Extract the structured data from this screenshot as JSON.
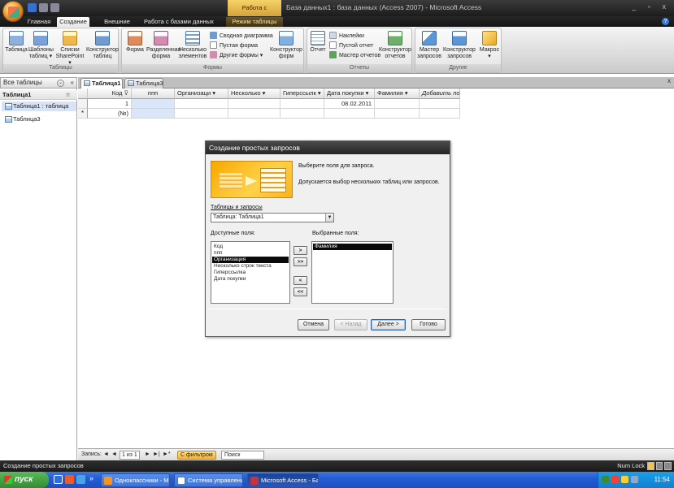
{
  "window": {
    "title": "База данных1 : база данных (Access 2007) - Microsoft Access",
    "context_label": "Работа с таблицами",
    "controls": "_ ▫ x"
  },
  "ribbon_tabs": [
    "Главная",
    "Создание",
    "Внешние данные",
    "Работа с базами данных",
    "Режим таблицы"
  ],
  "ribbon": {
    "groups": {
      "tables": "Таблицы",
      "forms": "Формы",
      "reports": "Отчеты",
      "other": "Другие"
    },
    "tables": [
      "Таблица",
      "Шаблоны таблиц ▾",
      "Списки SharePoint ▾",
      "Конструктор таблиц"
    ],
    "forms": [
      "Форма",
      "Разделенная форма",
      "Несколько элементов"
    ],
    "forms_small": [
      "Сводная диаграмма",
      "Пустая форма",
      "Другие формы ▾"
    ],
    "forms_design": "Конструктор форм",
    "reports_big": "Отчет",
    "reports_small": [
      "Наклейки",
      "Пустой отчет",
      "Мастер отчетов"
    ],
    "reports_design": "Конструктор отчетов",
    "other": [
      "Мастер запросов",
      "Конструктор запросов",
      "Макрос ▾"
    ]
  },
  "nav": {
    "header": "Все таблицы",
    "header_dd": "⌄",
    "header_chev": "«",
    "group": "Таблица1",
    "group_chev": "☆",
    "items": [
      "Таблица1 : таблица",
      "Таблица3"
    ]
  },
  "doc_tabs": [
    "Таблица1",
    "Таблица3"
  ],
  "doc_close": "x",
  "grid": {
    "headers": [
      "Код",
      "ппп",
      "Организаци ▾",
      "Несколько ▾",
      "Гиперссылк ▾",
      "Дата покупки ▾",
      "Фамилия ▾",
      "Добавить поле"
    ],
    "rows": [
      [
        "1",
        "",
        "",
        "",
        "",
        "08.02.2011",
        "",
        ""
      ],
      [
        "(№)",
        "",
        "",
        "",
        "",
        "",
        "",
        ""
      ]
    ],
    "new_row_marker": "*"
  },
  "recnav": {
    "label": "Запись:",
    "first": "◄",
    "prev": "◄",
    "position": "1 из 1",
    "next": "►",
    "last": "►|",
    "new": "►*",
    "filter": "С фильтром",
    "search": "Поиск"
  },
  "dialog": {
    "title": "Создание простых запросов",
    "prompt": "Выберите поля для запроса.",
    "hint": "Допускается выбор нескольких таблиц или запросов.",
    "tables_label": "Таблицы и запросы",
    "combo_value": "Таблица: Таблица1",
    "available_label": "Доступные поля:",
    "selected_label": "Выбранные поля:",
    "available_fields": [
      "Код",
      "ппп",
      "Организация",
      "Несколько строк текста",
      "Гиперссылка",
      "Дата покупки"
    ],
    "available_selected_index": 2,
    "selected_fields": [
      "Фамилия"
    ],
    "move_buttons": [
      ">",
      ">>",
      "<",
      "<<"
    ],
    "buttons": {
      "cancel": "Отмена",
      "back": "< Назад",
      "next": "Далее >",
      "finish": "Готово"
    }
  },
  "status": {
    "left": "Создание простых запросов",
    "right": "Num Lock"
  },
  "taskbar": {
    "start": "пуск",
    "tasks": [
      "Одноклассники - Мо...",
      "Система управлени...",
      "Microsoft Access - Ба..."
    ],
    "more": "»",
    "clock": "11:54"
  },
  "colors": {
    "accent": "#245dd4",
    "context_tab": "#d4a23a",
    "selection": "#0a0a0a"
  }
}
